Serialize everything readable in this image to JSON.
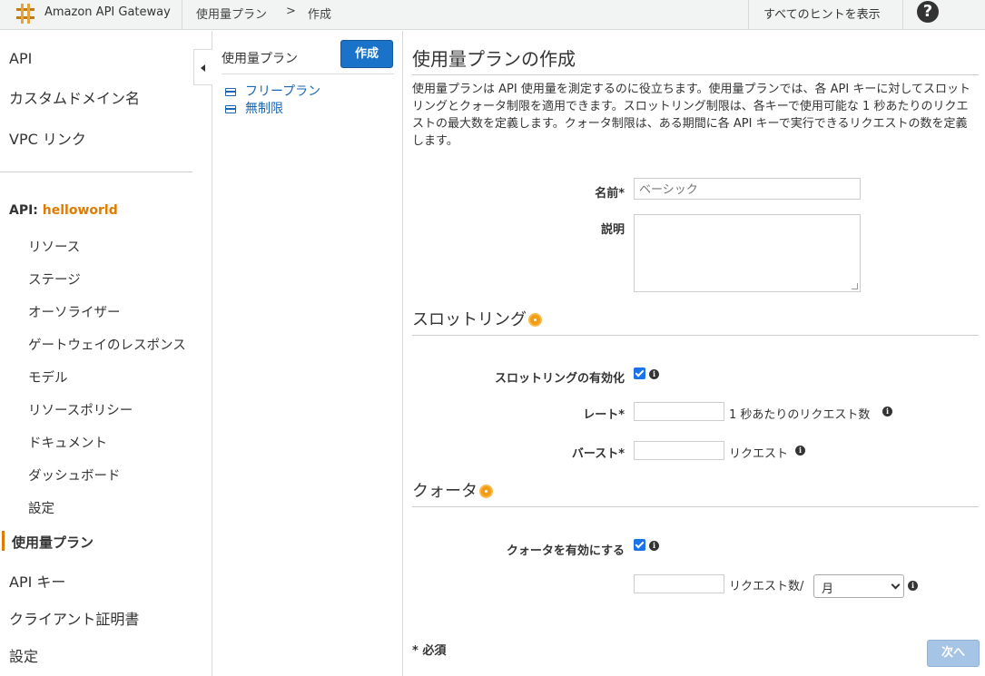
{
  "topbar": {
    "app_name": "Amazon API Gateway",
    "breadcrumb_1": "使用量プラン",
    "breadcrumb_sep": ">",
    "breadcrumb_2": "作成",
    "hints_link": "すべてのヒントを表示",
    "help_label": "?"
  },
  "sidebar": {
    "top_items": [
      {
        "label": "API"
      },
      {
        "label": "カスタムドメイン名"
      },
      {
        "label": "VPC リンク"
      }
    ],
    "api_prefix": "API:",
    "api_name": "helloworld",
    "api_items": [
      {
        "label": "リソース"
      },
      {
        "label": "ステージ"
      },
      {
        "label": "オーソライザー"
      },
      {
        "label": "ゲートウェイのレスポンス"
      },
      {
        "label": "モデル"
      },
      {
        "label": "リソースポリシー"
      },
      {
        "label": "ドキュメント"
      },
      {
        "label": "ダッシュボード"
      },
      {
        "label": "設定"
      }
    ],
    "bottom_items": [
      {
        "label": "使用量プラン",
        "active": true
      },
      {
        "label": "API キー"
      },
      {
        "label": "クライアント証明書"
      },
      {
        "label": "設定"
      }
    ],
    "accent_color": "#e07b00"
  },
  "plans_panel": {
    "title": "使用量プラン",
    "create_label": "作成",
    "plans": [
      {
        "name": "フリープラン"
      },
      {
        "name": "無制限"
      }
    ]
  },
  "main": {
    "title": "使用量プランの作成",
    "description": "使用量プランは API 使用量を測定するのに役立ちます。使用量プランでは、各 API キーに対してスロットリングとクォータ制限を適用できます。スロットリング制限は、各キーで使用可能な 1 秒あたりのリクエストの最大数を定義します。クォータ制限は、ある期間に各 API キーで実行できるリクエストの数を定義します。",
    "name_label": "名前*",
    "name_placeholder": "ベーシック",
    "description_label": "説明",
    "throttling": {
      "section_title": "スロットリング",
      "enable_label": "スロットリングの有効化",
      "enabled": true,
      "rate_label": "レート*",
      "rate_value": "",
      "rate_unit": "1 秒あたりのリクエスト数",
      "burst_label": "バースト*",
      "burst_value": "",
      "burst_unit": "リクエスト"
    },
    "quota": {
      "section_title": "クォータ",
      "enable_label": "クォータを有効にする",
      "enabled": true,
      "value": "",
      "unit": "リクエスト数/",
      "period": "月"
    },
    "required_note": "* 必須",
    "next_label": "次へ"
  }
}
